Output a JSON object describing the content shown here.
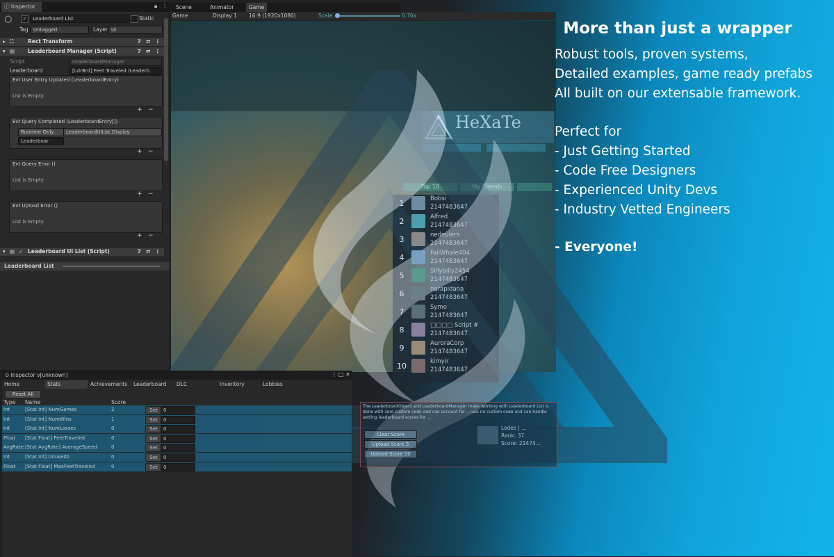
{
  "inspector": {
    "tab": "Inspector",
    "object_name": "Leaderboard List",
    "static_label": "Static",
    "tag_label": "Tag",
    "tag_value": "Untagged",
    "layer_label": "Layer",
    "layer_value": "UI",
    "components": {
      "rect_transform": "Rect Transform",
      "manager": "Leaderboard Manager (Script)",
      "ui_list": "Leaderboard UI List (Script)"
    },
    "script_label": "Script",
    "script_value": "LeaderboardManager",
    "leaderboard_label": "Leaderboard",
    "leaderboard_value": "[LdrBrd] Feet Traveled (Leaderb",
    "events": [
      {
        "title": "Evt User Entry Updated (LeaderboardEntry)",
        "empty": "List is Empty"
      },
      {
        "title": "Evt Query Completed (LeaderboardEntry[])",
        "runtime": "Runtime Only",
        "method": "LeaderboardUIList.Display",
        "object": "Leaderboar"
      },
      {
        "title": "Evt Query Error ()",
        "empty": "List is Empty"
      },
      {
        "title": "Evt Upload Error ()",
        "empty": "List is Empty"
      }
    ],
    "bottom_label": "Leaderboard List"
  },
  "game": {
    "tabs": [
      "Scene",
      "Animator",
      "Game"
    ],
    "display_mode": "Game",
    "display": "Display 1",
    "aspect": "16:9 (1920x1080)",
    "scale_label": "Scale",
    "scale_value": "0.76x",
    "logo_text": "HeXaTe",
    "ui_tabs": [
      "Top 10",
      "My Friends"
    ],
    "leaderboard": [
      {
        "rank": "1",
        "name": "Bobsi",
        "score": "2147483647"
      },
      {
        "rank": "2",
        "name": "Alfred",
        "score": "2147483647"
      },
      {
        "rank": "3",
        "name": "nedeulers",
        "score": "2147483647"
      },
      {
        "rank": "4",
        "name": "FailWhale404",
        "score": "2147483647"
      },
      {
        "rank": "5",
        "name": "Sillybilly2454",
        "score": "2147483647"
      },
      {
        "rank": "6",
        "name": "narapidana",
        "score": "2147483647"
      },
      {
        "rank": "7",
        "name": "Symo",
        "score": "2147483647"
      },
      {
        "rank": "8",
        "name": "□□□□ Script #",
        "score": "2147483647"
      },
      {
        "rank": "9",
        "name": "AuroraCorp",
        "score": "2147483647"
      },
      {
        "rank": "10",
        "name": "kimyir",
        "score": "2147483647"
      }
    ],
    "note": "The LeaderboardObject and LeaderboardManager make working with Leaderboard List is done with zero custom code and can account for ... use no custom code and can handle setting leaderboard scores for ...",
    "user_entry": {
      "name": "Lodes | ...",
      "rank": "Rank: 37",
      "score": "Score: 21474..."
    },
    "buttons": [
      "Clear Score",
      "Upload Score 5",
      "Upload Score 10"
    ]
  },
  "stats": {
    "title": "Inspector v[unknown]",
    "tabs": [
      "Home",
      "Stats",
      "Achievements",
      "Leaderboard",
      "DLC",
      "Inventory",
      "Lobbies"
    ],
    "reset_label": "Reset All",
    "columns": [
      "Type",
      "Name",
      "Score"
    ],
    "set_label": "Set",
    "rows": [
      {
        "type": "Int",
        "name": "[Stat Int] NumGames",
        "score": "2",
        "value": "0"
      },
      {
        "type": "Int",
        "name": "[Stat Int] NumWins",
        "score": "1",
        "value": "0"
      },
      {
        "type": "Int",
        "name": "[Stat Int] NumLosses",
        "score": "0",
        "value": "0"
      },
      {
        "type": "Float",
        "name": "[Stat Float] FeetTraveled",
        "score": "0",
        "value": "0"
      },
      {
        "type": "AvgRate",
        "name": "[Stat AvgRate] AverageSpeed",
        "score": "0",
        "value": "0"
      },
      {
        "type": "Int",
        "name": "[Stat Int] Unused2",
        "score": "0",
        "value": "0"
      },
      {
        "type": "Float",
        "name": "[Stat Float] MaxFeetTraveled",
        "score": "0",
        "value": "0"
      }
    ]
  },
  "promo": {
    "title": "More than just a wrapper",
    "lines": [
      "Robust tools, proven systems,",
      "Detailed examples, game ready prefabs",
      "All built on our extensable framework."
    ],
    "perfect_for": "Perfect for",
    "audiences": [
      "-  Just Getting Started",
      "-  Code Free Designers",
      "-  Experienced Unity Devs",
      "-  Industry Vetted Engineers"
    ],
    "closing": "- Everyone!"
  },
  "colors": {
    "promo_blue": "#12b3ea",
    "editor_bg": "#282828",
    "stat_row": "#1d5f7e"
  }
}
